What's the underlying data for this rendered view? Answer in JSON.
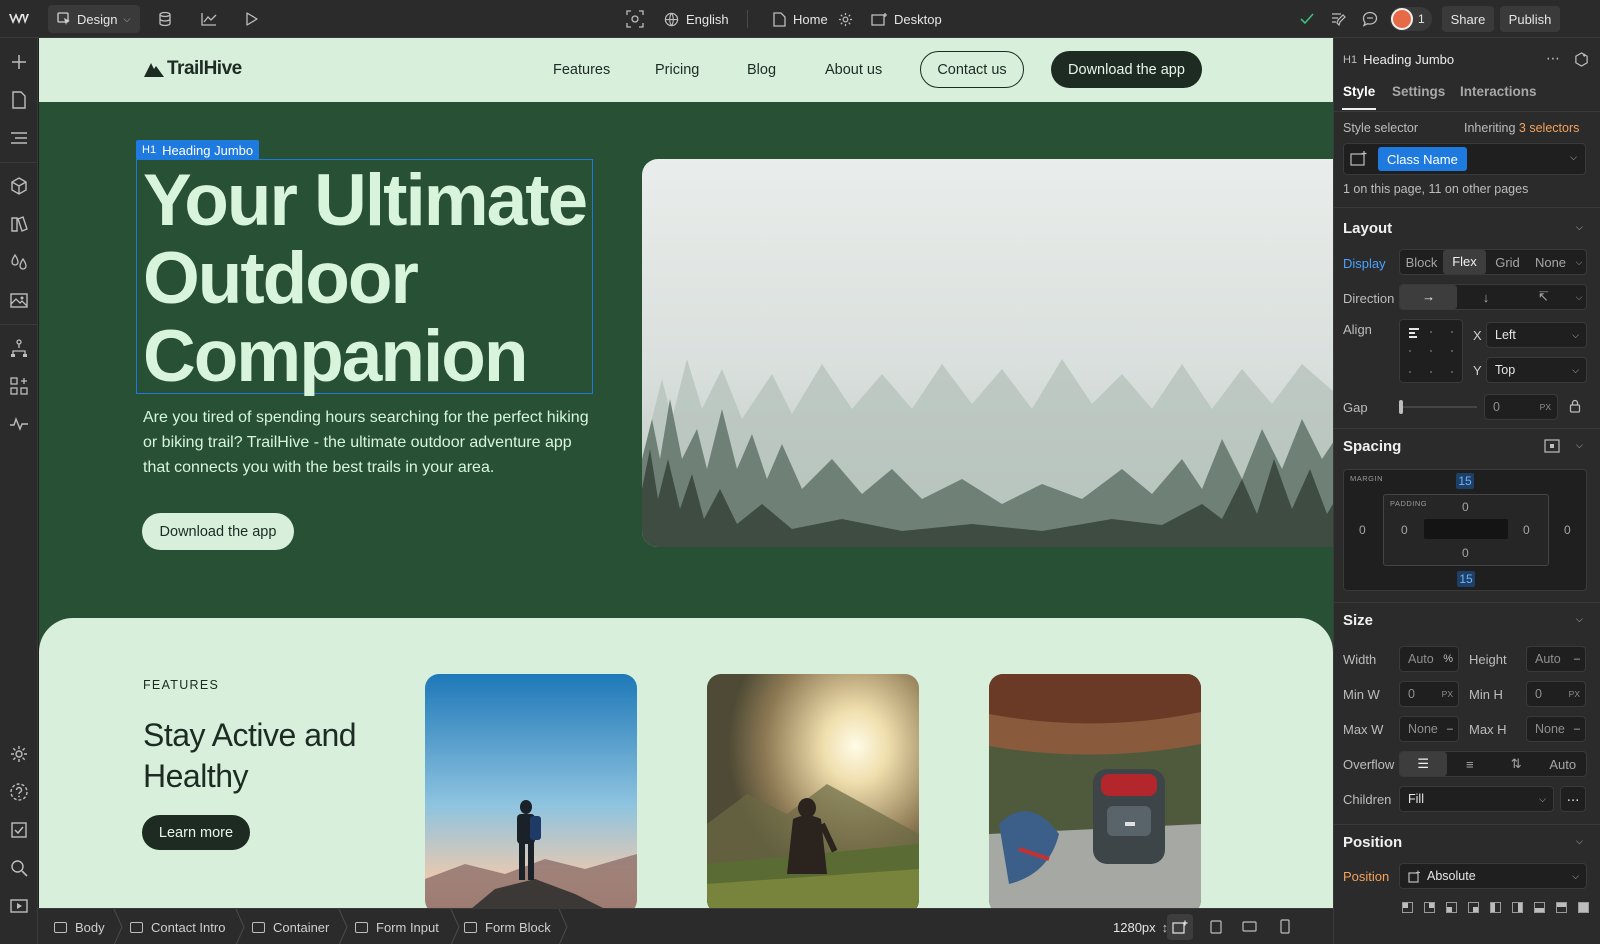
{
  "topbar": {
    "mode_label": "Design",
    "locale_label": "English",
    "page_label": "Home",
    "breakpoint_label": "Desktop",
    "collaborators_count": "1",
    "share_label": "Share",
    "publish_label": "Publish"
  },
  "site": {
    "logo_text": "TrailHive",
    "nav": [
      "Features",
      "Pricing",
      "Blog",
      "About us"
    ],
    "contact_label": "Contact us",
    "download_label": "Download the app",
    "selection_tag": "Heading Jumbo",
    "selection_tag_prefix": "H1",
    "hero_title_lines": [
      "Your Ultimate",
      "Outdoor",
      "Companion"
    ],
    "hero_body": "Are you tired of spending hours searching for the perfect hiking or biking trail? TrailHive - the ultimate outdoor adventure app that connects you with the best trails in your area.",
    "hero_button": "Download the app",
    "features_eyebrow": "FEATURES",
    "features_title": "Stay Active and Healthy",
    "features_button": "Learn more"
  },
  "panel": {
    "element_prefix": "H1",
    "element_name": "Heading Jumbo",
    "tabs": [
      "Style",
      "Settings",
      "Interactions"
    ],
    "style_selector_label": "Style selector",
    "inheriting_prefix": "Inheriting",
    "inheriting_count": "3 selectors",
    "class_name": "Class Name",
    "usage_text": "1 on this page, 11 on other pages",
    "layout": {
      "title": "Layout",
      "display_label": "Display",
      "display_options": [
        "Block",
        "Flex",
        "Grid",
        "None"
      ],
      "display_selected": "Flex",
      "direction_label": "Direction",
      "align_label": "Align",
      "x_label": "X",
      "x_value": "Left",
      "y_label": "Y",
      "y_value": "Top",
      "gap_label": "Gap",
      "gap_value": "0",
      "gap_unit": "PX"
    },
    "spacing": {
      "title": "Spacing",
      "margin_label": "MARGIN",
      "padding_label": "PADDING",
      "margin_top": "15",
      "margin_bottom": "15",
      "margin_left": "0",
      "margin_right": "0",
      "padding_top": "0",
      "padding_bottom": "0",
      "padding_left": "0",
      "padding_right": "0"
    },
    "size": {
      "title": "Size",
      "width_label": "Width",
      "width_value": "Auto",
      "width_unit": "%",
      "height_label": "Height",
      "height_value": "Auto",
      "height_unit": "–",
      "minw_label": "Min W",
      "minw_value": "0",
      "minw_unit": "PX",
      "minh_label": "Min H",
      "minh_value": "0",
      "minh_unit": "PX",
      "maxw_label": "Max W",
      "maxw_value": "None",
      "maxw_unit": "–",
      "maxh_label": "Max H",
      "maxh_value": "None",
      "maxh_unit": "–",
      "overflow_label": "Overflow",
      "overflow_auto": "Auto",
      "children_label": "Children",
      "children_value": "Fill"
    },
    "position": {
      "title": "Position",
      "label": "Position",
      "value": "Absolute"
    }
  },
  "bottombar": {
    "breadcrumbs": [
      "Body",
      "Contact Intro",
      "Container",
      "Form Input",
      "Form Block"
    ],
    "width_label": "1280px"
  },
  "colors": {
    "hero_green": "#275035",
    "mint": "#d8efdc",
    "selection_blue": "#1f7ae0",
    "accent_orange": "#f5a25d"
  }
}
